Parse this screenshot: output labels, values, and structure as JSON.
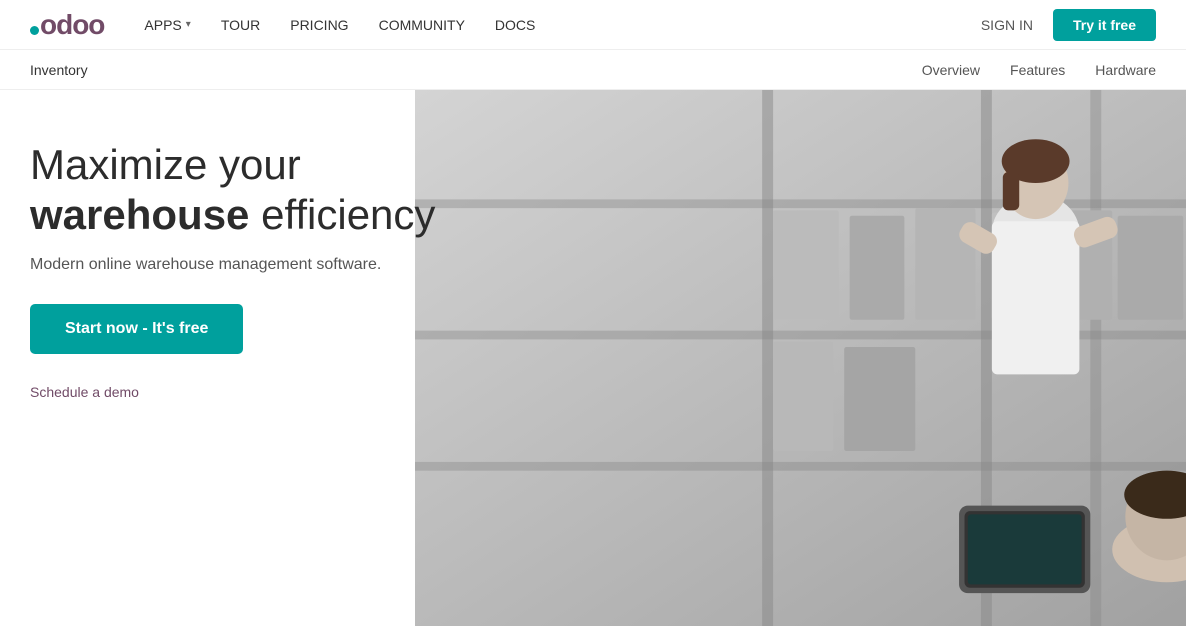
{
  "logo": {
    "text": "odoo",
    "color": "#714B67"
  },
  "topNav": {
    "items": [
      {
        "label": "APPS",
        "hasDropdown": true
      },
      {
        "label": "TOUR",
        "hasDropdown": false
      },
      {
        "label": "PRICING",
        "hasDropdown": false
      },
      {
        "label": "COMMUNITY",
        "hasDropdown": false
      },
      {
        "label": "DOCS",
        "hasDropdown": false
      }
    ],
    "signIn": "SIGN IN",
    "tryFree": "Try it free"
  },
  "secondaryNav": {
    "title": "Inventory",
    "links": [
      {
        "label": "Overview"
      },
      {
        "label": "Features"
      },
      {
        "label": "Hardware"
      }
    ]
  },
  "hero": {
    "headline_part1": "Maximize your",
    "headline_bold": "warehouse",
    "headline_part2": "efficiency",
    "subtext": "Modern online warehouse management software.",
    "ctaButton": "Start now - It's free",
    "demoLink": "Schedule a demo"
  }
}
